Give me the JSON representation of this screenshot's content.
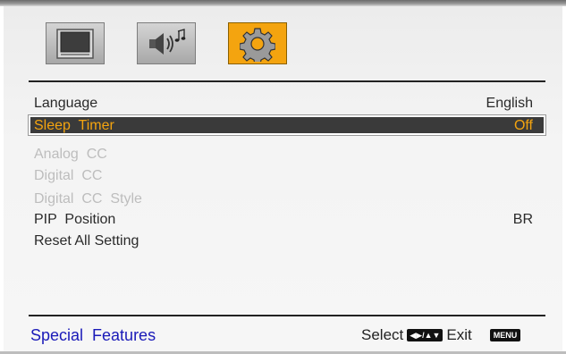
{
  "tabs": [
    {
      "id": "picture",
      "icon": "tv-icon",
      "active": false
    },
    {
      "id": "audio",
      "icon": "speaker-music-icon",
      "active": false
    },
    {
      "id": "setup",
      "icon": "gear-icon",
      "active": true
    }
  ],
  "menu": {
    "language": {
      "label": "Language",
      "value": "English"
    },
    "sleep_timer": {
      "label": "Sleep  Timer",
      "value": "Off"
    },
    "analog_cc": {
      "label": "Analog  CC"
    },
    "digital_cc": {
      "label": "Digital  CC"
    },
    "digital_cc_style": {
      "label": "Digital  CC  Style"
    },
    "pip_position": {
      "label": "PIP  Position",
      "value": "BR"
    },
    "reset_all": {
      "label": "Reset All Setting"
    }
  },
  "footer": {
    "title": "Special  Features",
    "select_label": "Select",
    "select_key": "◀▶/▲▼",
    "exit_label": "Exit",
    "menu_key": "MENU"
  },
  "colors": {
    "accent": "#f4a40f",
    "highlight_text": "#f4a40f",
    "footer_title": "#1a1ab8",
    "disabled_text": "#bdbdbd"
  }
}
